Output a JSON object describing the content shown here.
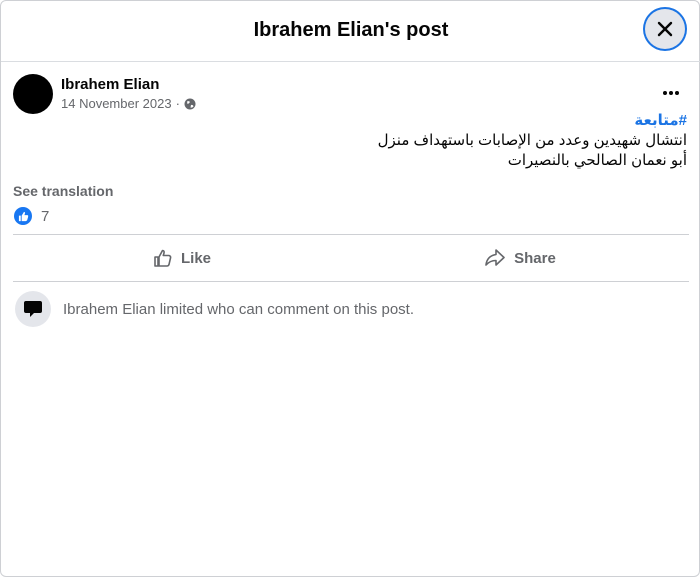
{
  "header": {
    "title": "Ibrahem Elian's post"
  },
  "post": {
    "author": "Ibrahem Elian",
    "date": "14 November 2023",
    "date_separator": "·",
    "privacy_icon": "globe-icon",
    "hashtag": "#متابعة",
    "text_line1": "انتشال شهيدين وعدد من الإصابات باستهداف منزل",
    "text_line2": "أبو نعمان الصالحي بالنصيرات",
    "see_translation": "See translation",
    "reaction_icon": "like-reaction-icon",
    "reaction_count": "7"
  },
  "actions": {
    "like": "Like",
    "share": "Share"
  },
  "comments": {
    "restriction_text": "Ibrahem Elian limited who can comment on this post."
  },
  "colors": {
    "link": "#1b74e4",
    "like_badge": "#1877f2",
    "secondary_text": "#65676b"
  }
}
